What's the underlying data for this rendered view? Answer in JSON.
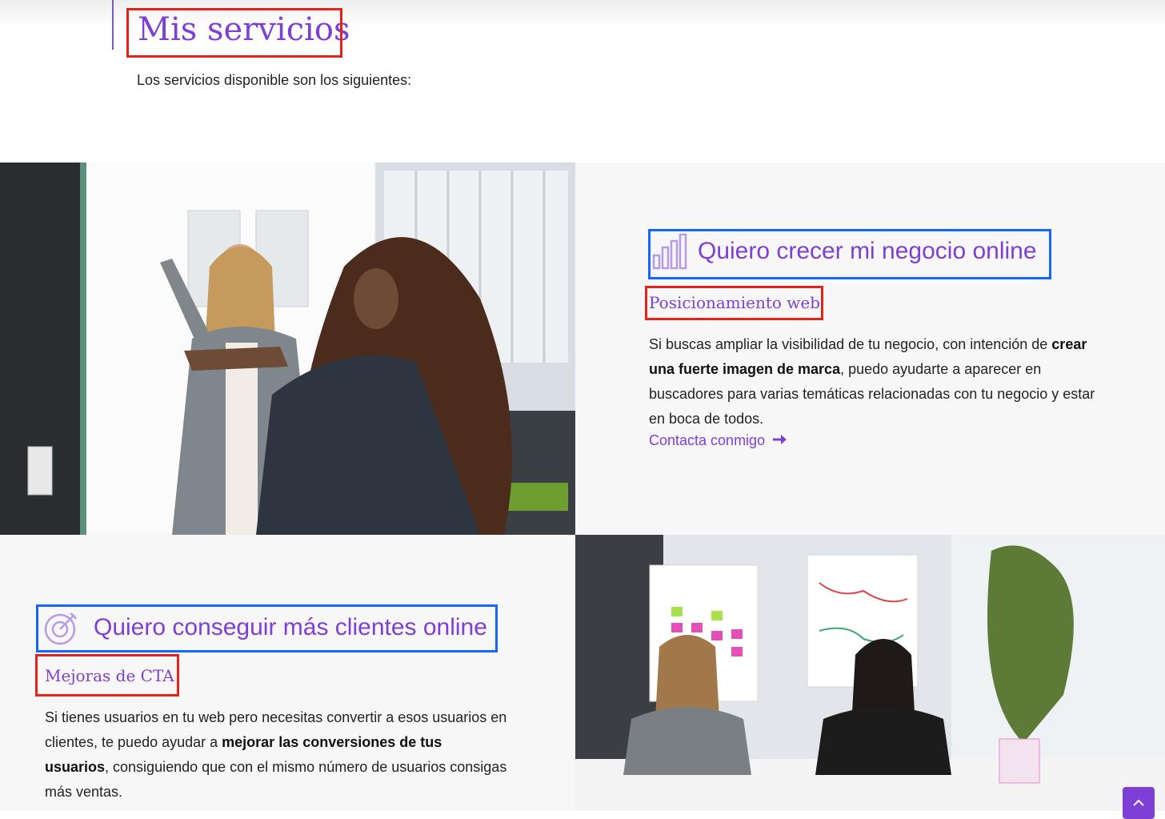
{
  "header": {
    "title": "Mis servicios",
    "intro": "Los servicios disponible son los siguientes:"
  },
  "services": [
    {
      "heading": "Quiero crecer mi negocio online",
      "icon": "bar-chart-icon",
      "subtitle": "Posicionamiento web",
      "description": {
        "part1": "Si buscas ampliar la visibilidad de tu negocio, con intención de ",
        "bold": "crear una fuerte imagen de marca",
        "part2": ", puedo ayudarte a aparecer en buscadores para varias temáticas relacionadas con tu negocio y estar en boca de todos."
      },
      "cta": "Contacta conmigo",
      "image": "two-women-whiteboard-photo"
    },
    {
      "heading": "Quiero conseguir más clientes online",
      "icon": "target-icon",
      "subtitle": "Mejoras de CTA",
      "description": {
        "part1": "Si tienes usuarios en tu web pero necesitas convertir a esos usuarios en clientes, te puedo ayudar a ",
        "bold": "mejorar las conversiones de tus usuarios",
        "part2": ", consiguiendo que con el mismo número de usuarios consigas más ventas."
      },
      "image": "meeting-room-photo"
    }
  ],
  "scroll_top": {
    "icon": "chevron-up-icon"
  },
  "colors": {
    "accent": "#7e3fd6",
    "highlight_red": "#e5231b",
    "highlight_blue": "#1565ff"
  }
}
